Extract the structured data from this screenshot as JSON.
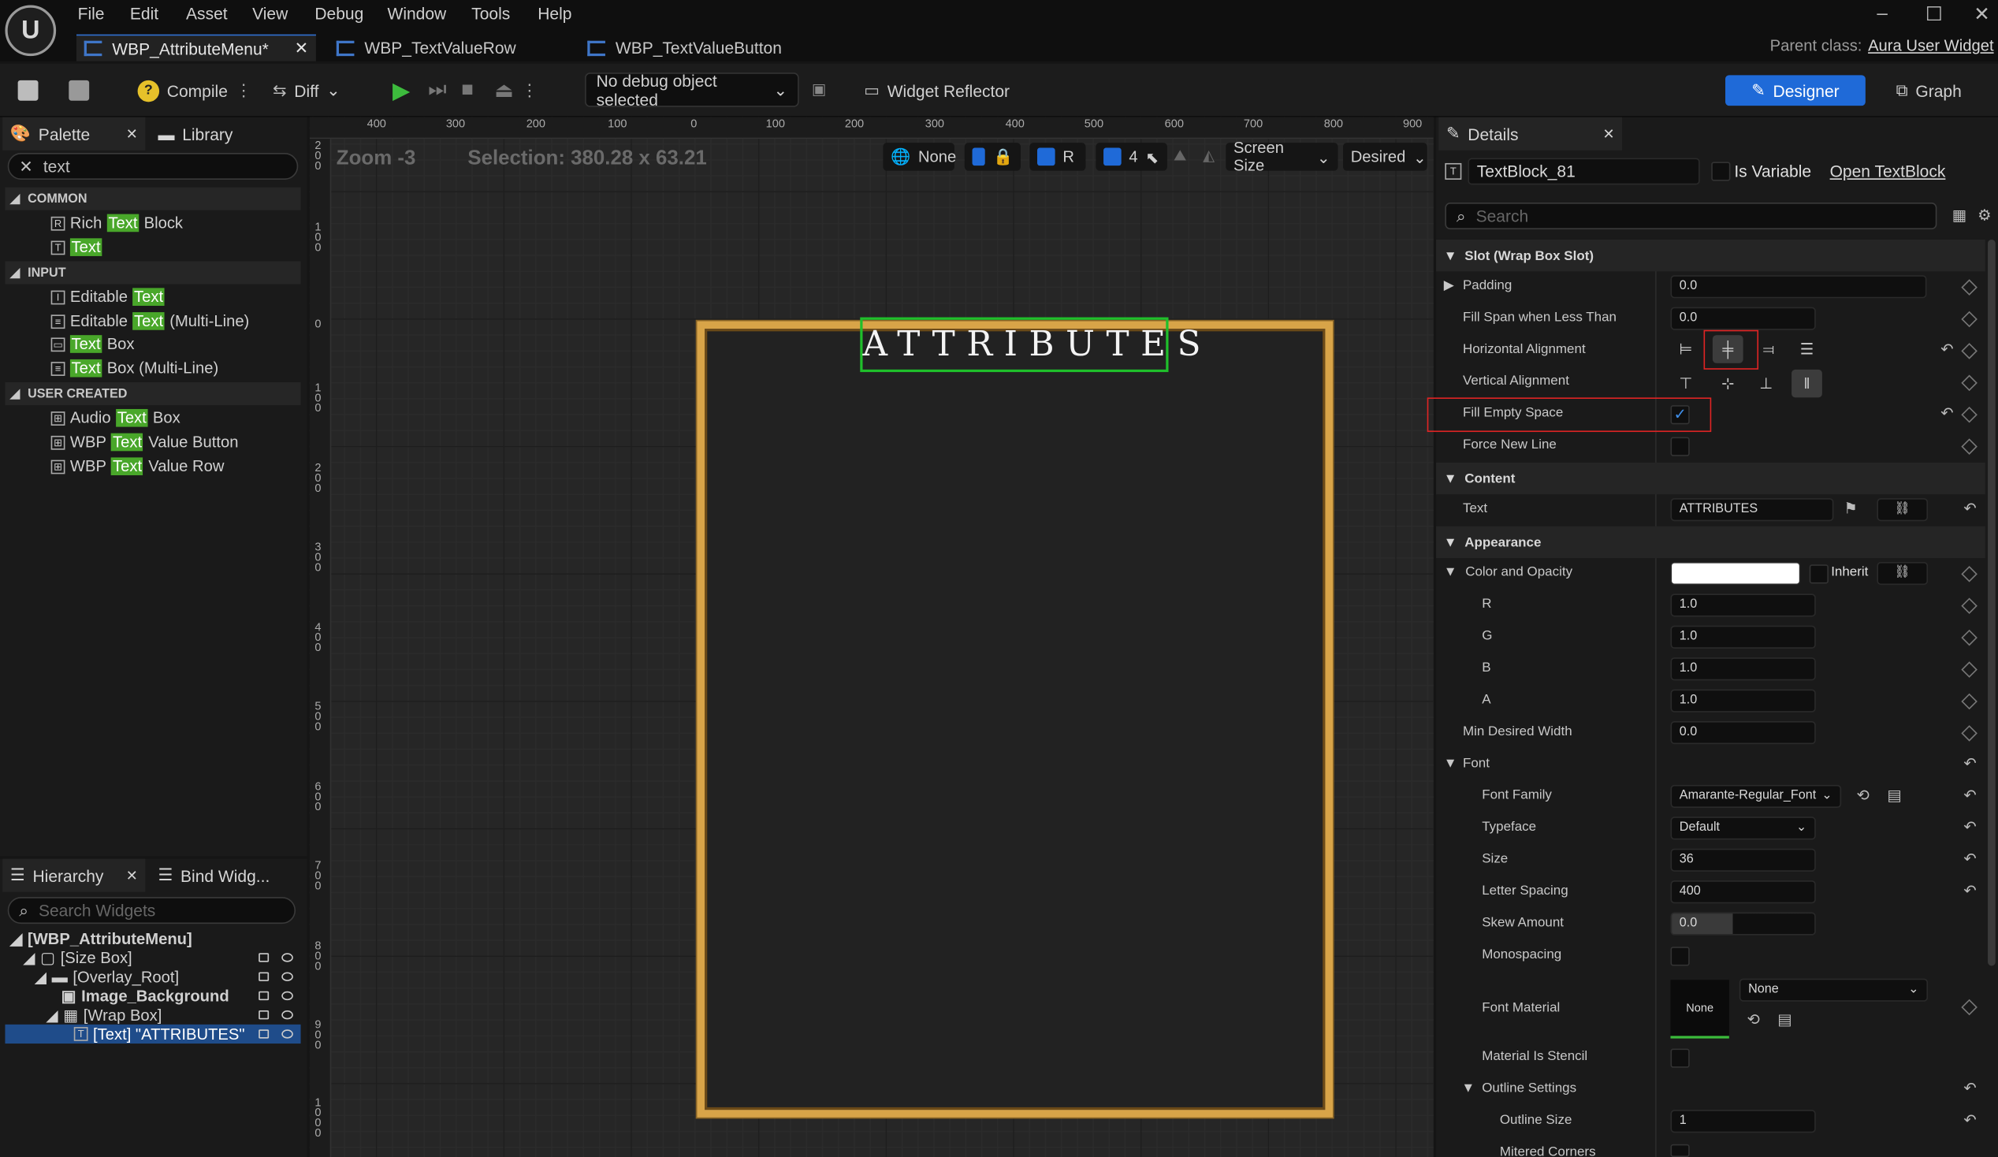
{
  "menu": {
    "items": [
      "File",
      "Edit",
      "Asset",
      "View",
      "Debug",
      "Window",
      "Tools",
      "Help"
    ]
  },
  "tabs": [
    {
      "label": "WBP_AttributeMenu*",
      "active": true
    },
    {
      "label": "WBP_TextValueRow",
      "active": false
    },
    {
      "label": "WBP_TextValueButton",
      "active": false
    }
  ],
  "parent_class": {
    "label": "Parent class:",
    "value": "Aura User Widget"
  },
  "toolbar": {
    "compile": "Compile",
    "diff": "Diff",
    "debug_object": "No debug object selected",
    "widget_reflector": "Widget Reflector",
    "designer": "Designer",
    "graph": "Graph"
  },
  "palette": {
    "tab_label": "Palette",
    "library_label": "Library",
    "search_value": "text",
    "search_highlight": "Text",
    "categories": [
      {
        "label": "COMMON",
        "items": [
          {
            "pre": "Rich ",
            "post": " Block",
            "icon": "rich-text-icon"
          },
          {
            "pre": "",
            "post": "",
            "icon": "text-icon"
          }
        ]
      },
      {
        "label": "INPUT",
        "items": [
          {
            "pre": "Editable ",
            "post": "",
            "icon": "editable-text-icon"
          },
          {
            "pre": "Editable ",
            "post": " (Multi-Line)",
            "icon": "editable-multiline-icon"
          },
          {
            "pre": "",
            "post": " Box",
            "icon": "text-box-icon"
          },
          {
            "pre": "",
            "post": " Box (Multi-Line)",
            "icon": "text-box-multiline-icon"
          }
        ]
      },
      {
        "label": "USER CREATED",
        "items": [
          {
            "pre": "Audio ",
            "post": " Box",
            "icon": "widget-icon"
          },
          {
            "pre": "WBP ",
            "post": " Value Button",
            "icon": "widget-icon"
          },
          {
            "pre": "WBP ",
            "post": " Value Row",
            "icon": "widget-icon"
          }
        ]
      }
    ]
  },
  "hierarchy": {
    "tab_label": "Hierarchy",
    "bind_label": "Bind Widg...",
    "search_placeholder": "Search Widgets",
    "rows": [
      {
        "label": "[WBP_AttributeMenu]",
        "indent": 0,
        "bold": true
      },
      {
        "label": "[Size Box]",
        "indent": 1
      },
      {
        "label": "[Overlay_Root]",
        "indent": 2
      },
      {
        "label": "Image_Background",
        "indent": 3,
        "bold": true
      },
      {
        "label": "[Wrap Box]",
        "indent": 3
      },
      {
        "label": "[Text] \"ATTRIBUTES\"",
        "indent": 4,
        "selected": true
      }
    ]
  },
  "viewport": {
    "zoom": "Zoom -3",
    "selection": "Selection: 380.28 x 63.21",
    "none_label": "None",
    "r_label": "R",
    "grid_count": "4",
    "screen_size": "Screen Size",
    "desired": "Desired",
    "title_text": "ATTRIBUTES",
    "ruler_h": [
      "400",
      "300",
      "200",
      "100",
      "0",
      "100",
      "200",
      "300",
      "400",
      "500",
      "600",
      "700",
      "800",
      "900"
    ],
    "ruler_v": [
      "2\n0\n0",
      "1\n0\n0",
      "0",
      "1\n0\n0",
      "2\n0\n0",
      "3\n0\n0",
      "4\n0\n0",
      "5\n0\n0",
      "6\n0\n0",
      "7\n0\n0",
      "8\n0\n0",
      "9\n0\n0",
      "1\n0\n0\n0"
    ]
  },
  "details": {
    "tab_label": "Details",
    "widget_name": "TextBlock_81",
    "is_variable": "Is Variable",
    "open_link": "Open TextBlock",
    "search_placeholder": "Search",
    "slot_section": "Slot (Wrap Box Slot)",
    "padding": {
      "label": "Padding",
      "value": "0.0"
    },
    "fill_span": {
      "label": "Fill Span when Less Than",
      "value": "0.0"
    },
    "h_align": {
      "label": "Horizontal Alignment"
    },
    "v_align": {
      "label": "Vertical Alignment"
    },
    "fill_empty": {
      "label": "Fill Empty Space",
      "checked": true
    },
    "force_new_line": {
      "label": "Force New Line",
      "checked": false
    },
    "content_section": "Content",
    "text": {
      "label": "Text",
      "value": "ATTRIBUTES"
    },
    "appearance_section": "Appearance",
    "color_opacity": {
      "label": "Color and Opacity",
      "inherit": "Inherit"
    },
    "r": {
      "label": "R",
      "value": "1.0"
    },
    "g": {
      "label": "G",
      "value": "1.0"
    },
    "b": {
      "label": "B",
      "value": "1.0"
    },
    "a": {
      "label": "A",
      "value": "1.0"
    },
    "min_width": {
      "label": "Min Desired Width",
      "value": "0.0"
    },
    "font_section": "Font",
    "font_family": {
      "label": "Font Family",
      "value": "Amarante-Regular_Font"
    },
    "typeface": {
      "label": "Typeface",
      "value": "Default"
    },
    "size": {
      "label": "Size",
      "value": "36"
    },
    "letter_spacing": {
      "label": "Letter Spacing",
      "value": "400"
    },
    "skew": {
      "label": "Skew Amount",
      "value": "0.0"
    },
    "monospacing": {
      "label": "Monospacing"
    },
    "font_material": {
      "label": "Font Material",
      "thumb": "None",
      "value": "None"
    },
    "stencil": {
      "label": "Material Is Stencil"
    },
    "outline_settings": {
      "label": "Outline Settings"
    },
    "outline_size": {
      "label": "Outline Size",
      "value": "1"
    },
    "mitered": {
      "label": "Mitered Corners"
    }
  },
  "colors": {
    "accent": "#1f6ad8",
    "highlight": "#49a72a",
    "selection": "#1fbf2b",
    "frame": "#d8a448",
    "callout": "#e02424"
  }
}
